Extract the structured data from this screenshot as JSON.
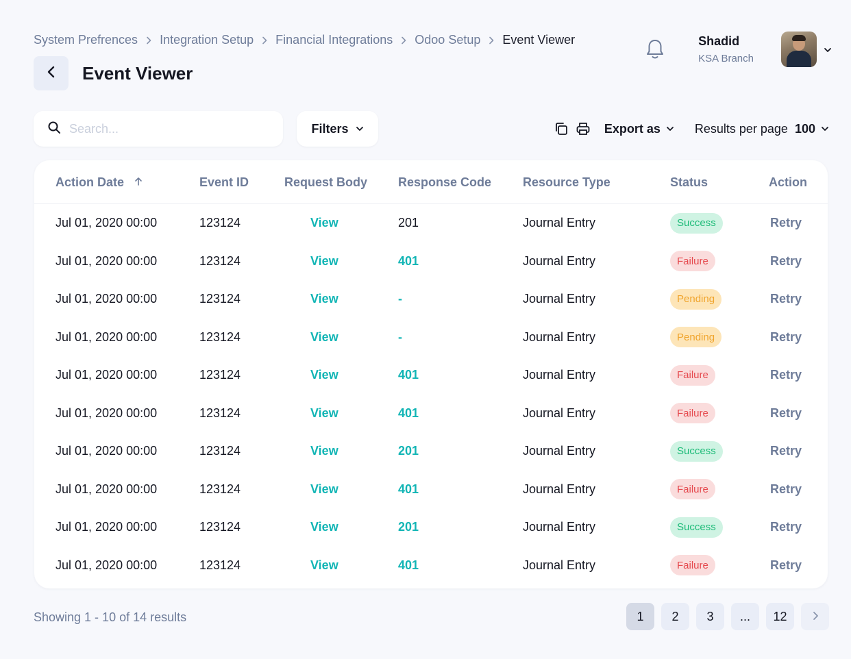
{
  "breadcrumb": [
    "System Prefrences",
    "Integration Setup",
    "Financial Integrations",
    "Odoo Setup",
    "Event Viewer"
  ],
  "page": {
    "title": "Event Viewer"
  },
  "user": {
    "name": "Shadid",
    "branch": "KSA Branch"
  },
  "toolbar": {
    "search_placeholder": "Search...",
    "filters_label": "Filters",
    "export_label": "Export as",
    "results_per_page_label": "Results per page",
    "results_per_page_value": "100"
  },
  "table": {
    "columns": [
      "Action Date",
      "Event ID",
      "Request Body",
      "Response Code",
      "Resource Type",
      "Status",
      "Action"
    ],
    "rows": [
      {
        "date": "Jul 01, 2020 00:00",
        "event_id": "123124",
        "request": "View",
        "code": "201",
        "code_style": "plain",
        "resource": "Journal Entry",
        "status": "Success",
        "action": "Retry"
      },
      {
        "date": "Jul 01, 2020 00:00",
        "event_id": "123124",
        "request": "View",
        "code": "401",
        "code_style": "link",
        "resource": "Journal Entry",
        "status": "Failure",
        "action": "Retry"
      },
      {
        "date": "Jul 01, 2020 00:00",
        "event_id": "123124",
        "request": "View",
        "code": "-",
        "code_style": "link",
        "resource": "Journal Entry",
        "status": "Pending",
        "action": "Retry"
      },
      {
        "date": "Jul 01, 2020 00:00",
        "event_id": "123124",
        "request": "View",
        "code": "-",
        "code_style": "link",
        "resource": "Journal Entry",
        "status": "Pending",
        "action": "Retry"
      },
      {
        "date": "Jul 01, 2020 00:00",
        "event_id": "123124",
        "request": "View",
        "code": "401",
        "code_style": "link",
        "resource": "Journal Entry",
        "status": "Failure",
        "action": "Retry"
      },
      {
        "date": "Jul 01, 2020 00:00",
        "event_id": "123124",
        "request": "View",
        "code": "401",
        "code_style": "link",
        "resource": "Journal Entry",
        "status": "Failure",
        "action": "Retry"
      },
      {
        "date": "Jul 01, 2020 00:00",
        "event_id": "123124",
        "request": "View",
        "code": "201",
        "code_style": "link",
        "resource": "Journal Entry",
        "status": "Success",
        "action": "Retry"
      },
      {
        "date": "Jul 01, 2020 00:00",
        "event_id": "123124",
        "request": "View",
        "code": "401",
        "code_style": "link",
        "resource": "Journal Entry",
        "status": "Failure",
        "action": "Retry"
      },
      {
        "date": "Jul 01, 2020 00:00",
        "event_id": "123124",
        "request": "View",
        "code": "201",
        "code_style": "link",
        "resource": "Journal Entry",
        "status": "Success",
        "action": "Retry"
      },
      {
        "date": "Jul 01, 2020 00:00",
        "event_id": "123124",
        "request": "View",
        "code": "401",
        "code_style": "link",
        "resource": "Journal Entry",
        "status": "Failure",
        "action": "Retry"
      }
    ]
  },
  "footer": {
    "summary": "Showing 1 - 10 of 14 results",
    "pages": [
      "1",
      "2",
      "3",
      "...",
      "12"
    ],
    "active_page": "1"
  },
  "colors": {
    "accent": "#12B5B5",
    "success": "#1DBB78",
    "failure": "#E5484D",
    "pending": "#F0A42C",
    "muted": "#6E7C99"
  }
}
